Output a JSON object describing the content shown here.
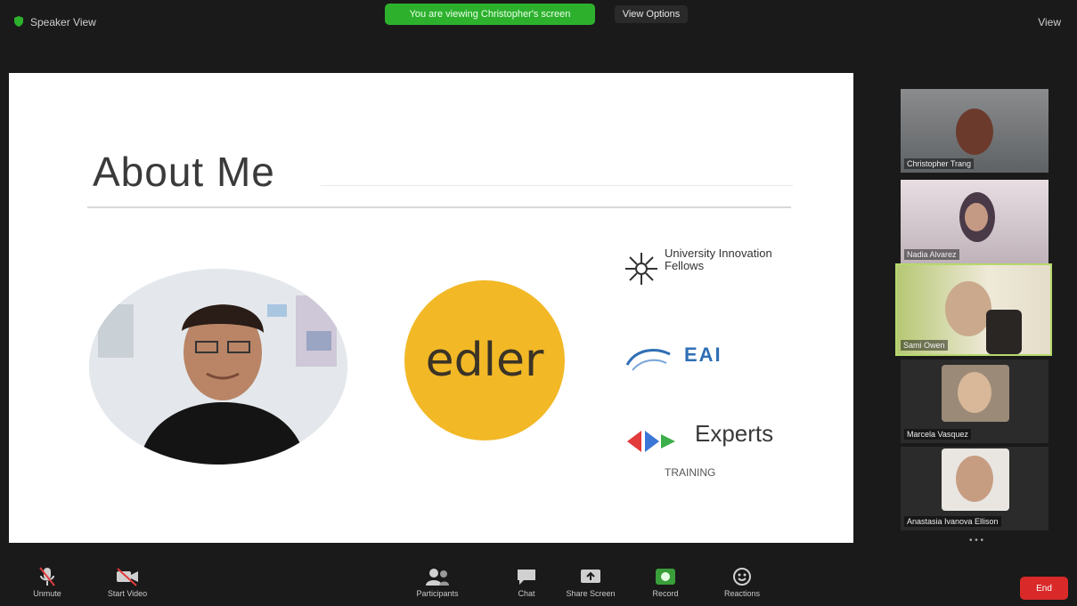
{
  "header": {
    "view_label": "Speaker View",
    "share_banner": "You are viewing Christopher's screen",
    "view_options": "View Options",
    "view_button": "View"
  },
  "slide": {
    "title": "About Me",
    "logo_uif_text": "University Innovation Fellows",
    "logo_eai_text": "EAI",
    "logo_experts_text": "Experts",
    "logo_experts_sub": "TRAINING",
    "logo_edler_text": "edler"
  },
  "participants": [
    {
      "name": "Christopher Trang"
    },
    {
      "name": "Nadia Alvarez"
    },
    {
      "name": "Sami Owen"
    },
    {
      "name": "Marcela Vasquez"
    },
    {
      "name": "Anastasia Ivanova Ellison"
    }
  ],
  "toolbar": {
    "unmute": "Unmute",
    "start_video": "Start Video",
    "participants": "Participants",
    "chat": "Chat",
    "share_screen": "Share Screen",
    "record": "Record",
    "reactions": "Reactions",
    "end": "End"
  },
  "colors": {
    "share_green": "#2db12d",
    "end_red": "#d92929",
    "edler_yellow": "#f2b826",
    "eai_blue": "#2f6fb5"
  }
}
